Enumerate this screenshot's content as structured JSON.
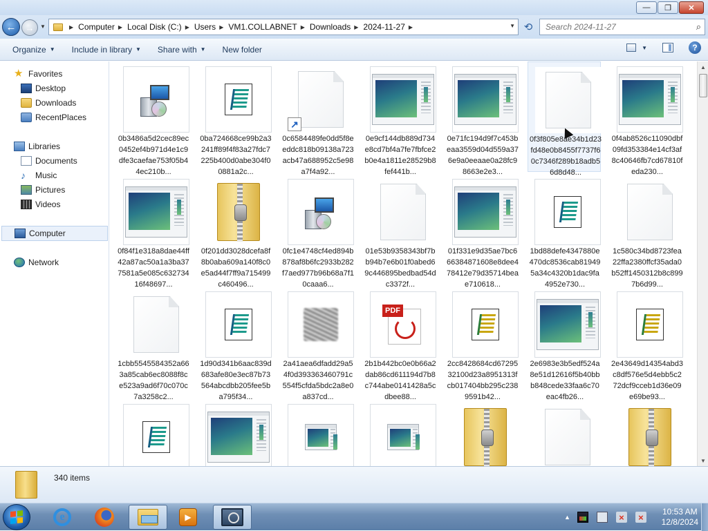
{
  "window": {
    "controls": {
      "minimize": "—",
      "maximize": "❐",
      "close": "✕"
    }
  },
  "address": {
    "crumbs": [
      "Computer",
      "Local Disk (C:)",
      "Users",
      "VM1.COLLABNET",
      "Downloads",
      "2024-11-27"
    ],
    "search_placeholder": "Search 2024-11-27"
  },
  "commands": {
    "organize": "Organize",
    "include_in_library": "Include in library",
    "share_with": "Share with",
    "new_folder": "New folder"
  },
  "nav": {
    "favorites": "Favorites",
    "desktop": "Desktop",
    "downloads": "Downloads",
    "recentplaces": "RecentPlaces",
    "libraries": "Libraries",
    "documents": "Documents",
    "music": "Music",
    "pictures": "Pictures",
    "videos": "Videos",
    "computer": "Computer",
    "network": "Network"
  },
  "files": [
    {
      "name": "0b3486a5d2cec89ec0452ef4b971d4e1c9dfe3caefae753f05b44ec210b...",
      "icon": "installer-icon"
    },
    {
      "name": "0ba724668ce99b2a3241ff89f4f83a27fdc7225b400d0abe304f00881a2c...",
      "icon": "script-icon"
    },
    {
      "name": "0c6584489fe0dd5f8eeddc818b09138a723acb47a688952c5e98a7f4a92...",
      "icon": "shortcut-file-icon"
    },
    {
      "name": "0e9cf144db889d734e8cd7bf4a7fe7fbfce2b0e4a1811e28529b8fef441b...",
      "icon": "document-preview-icon"
    },
    {
      "name": "0e71fc194d9f7c453beaa3559d04d559a376e9a0eeaae0a28fc98663e2e3...",
      "icon": "document-preview-icon"
    },
    {
      "name": "0f3f805e8ae34b1d23fd48e0b8455f7737f60c7346f289b18adb56d8d48...",
      "icon": "blank-file-icon"
    },
    {
      "name": "0f4ab8526c11090dbf09fd353384e14cf3af8c40646fb7cd67810feda230...",
      "icon": "document-preview-icon"
    },
    {
      "name": "0f84f1e318a8dae44ff42a87ac50a1a3ba377581a5e085c63273416f48697...",
      "icon": "document-preview-icon"
    },
    {
      "name": "0f201dd3028dcefa8f8b0aba609a140f8c0e5ad44f7ff9a715499c460496...",
      "icon": "zip-folder-icon"
    },
    {
      "name": "0fc1e4748cf4ed894b878af8b6fc2933b282f7aed977b96b68a7f10caaa6...",
      "icon": "installer-icon"
    },
    {
      "name": "01e53b9358343bf7bb94b7e6b01f0abed69c446895bedbad54dc3372f...",
      "icon": "blank-file-icon"
    },
    {
      "name": "01f331e9d35ae7bc666384871608e8dee478412e79d35714beae710618...",
      "icon": "document-preview-icon"
    },
    {
      "name": "1bd88defe4347880e470dc8536cab819495a34c4320b1dac9fa4952e730...",
      "icon": "script-icon"
    },
    {
      "name": "1c580c34bd8723fea22ffa2380ffcf35ada0b52ff1450312b8c8997b6d99...",
      "icon": "blank-file-icon"
    },
    {
      "name": "1cbb5545584352a663a85cab6ec8088f8ce523a9ad6f70c070c7a3258c2...",
      "icon": "blank-file-icon"
    },
    {
      "name": "1d90d341b6aac839d683afe80e3ec87b73564abcdbb205fee5ba795f34...",
      "icon": "script-icon"
    },
    {
      "name": "2a41aea6dfadd29a54f0d393363460791c554f5cfda5bdc2a8e0a837cd...",
      "icon": "image-thumbnail-icon"
    },
    {
      "name": "2b1b442bc0e0b66a2dab86cd611194d7b8c744abe0141428a5cdbee88...",
      "icon": "pdf-icon"
    },
    {
      "name": "2cc8428684cd6729532100d23a8951313fcb017404bb295c2389591b42...",
      "icon": "script-yellow-icon"
    },
    {
      "name": "2e6983e3b5edf524a8e51d12616f5b40bbb848cede33faa6c70eac4fb26...",
      "icon": "document-preview-icon"
    },
    {
      "name": "2e43649d14354abd3c8df576e5d4ebb5c272dcf9cceb1d36e09e69be93...",
      "icon": "script-yellow-icon"
    },
    {
      "name": "",
      "icon": "script-icon"
    },
    {
      "name": "",
      "icon": "document-preview-icon"
    },
    {
      "name": "",
      "icon": "document-preview-small-icon"
    },
    {
      "name": "",
      "icon": "document-preview-small-icon"
    },
    {
      "name": "",
      "icon": "zip-folder-icon"
    },
    {
      "name": "",
      "icon": "blank-file-icon"
    },
    {
      "name": "",
      "icon": "zip-folder-icon"
    }
  ],
  "details": {
    "count": "340 items"
  },
  "taskbar": {
    "clock_time": "10:53 AM",
    "clock_date": "12/8/2024"
  },
  "colors": {
    "titlebar": "#c9dcf2",
    "taskbar": "#6f8fb5",
    "accent": "#1e395b"
  }
}
